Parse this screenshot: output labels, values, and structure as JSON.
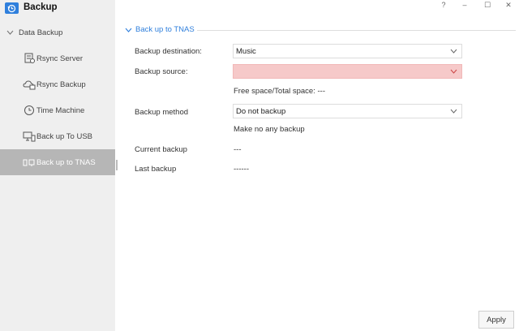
{
  "app": {
    "title": "Backup"
  },
  "window_controls": {
    "help": "?",
    "minimize": "–",
    "maximize": "☐",
    "close": "✕"
  },
  "sidebar": {
    "group_label": "Data Backup",
    "items": [
      {
        "label": "Rsync Server",
        "icon": "rsync-server-icon"
      },
      {
        "label": "Rsync Backup",
        "icon": "rsync-backup-icon"
      },
      {
        "label": "Time Machine",
        "icon": "time-machine-icon"
      },
      {
        "label": "Back up To USB",
        "icon": "usb-backup-icon"
      },
      {
        "label": "Back up to TNAS",
        "icon": "tnas-backup-icon",
        "active": true
      }
    ]
  },
  "section": {
    "title": "Back up to TNAS"
  },
  "form": {
    "destination_label": "Backup destination:",
    "destination_value": "Music",
    "source_label": "Backup source:",
    "source_value": "",
    "space_info": "Free space/Total space: ---",
    "method_label": "Backup method",
    "method_value": "Do not backup",
    "method_hint": "Make no any backup",
    "current_label": "Current backup",
    "current_value": "---",
    "last_label": "Last backup",
    "last_value": "------"
  },
  "footer": {
    "apply_label": "Apply"
  },
  "colors": {
    "accent": "#2f7fdc",
    "sidebar_bg": "#efefef",
    "active_bg": "#b6b6b6",
    "error_bg": "#f6c9c9"
  }
}
